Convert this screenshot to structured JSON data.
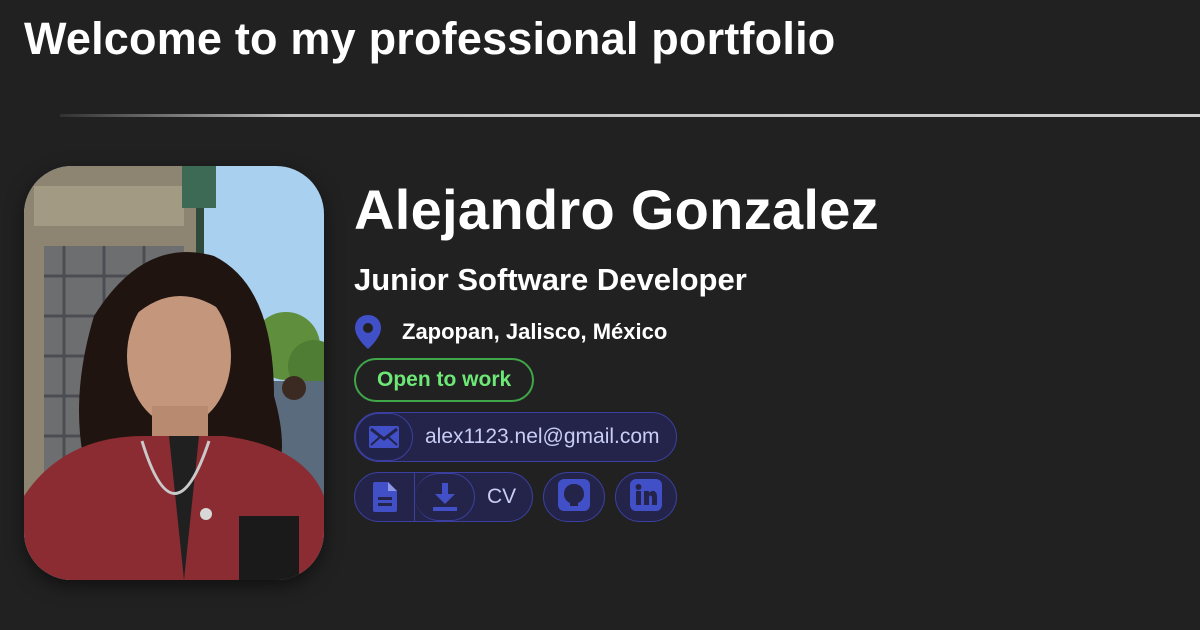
{
  "header": {
    "welcome": "Welcome to my professional portfolio"
  },
  "profile": {
    "photo_alt": "profile-photo",
    "name": "Alejandro Gonzalez",
    "role": "Junior Software Developer",
    "location": "Zapopan, Jalisco, México",
    "status": "Open to work",
    "email": "alex1123.nel@gmail.com"
  },
  "links": {
    "cv_label": "CV",
    "icons": [
      "document-icon",
      "download-icon",
      "github-icon",
      "linkedin-icon",
      "mail-icon",
      "location-pin-icon"
    ]
  },
  "colors": {
    "background": "#212121",
    "accent": "#4150c7",
    "pill_border": "#3b40a0",
    "status_green": "#6de876"
  }
}
